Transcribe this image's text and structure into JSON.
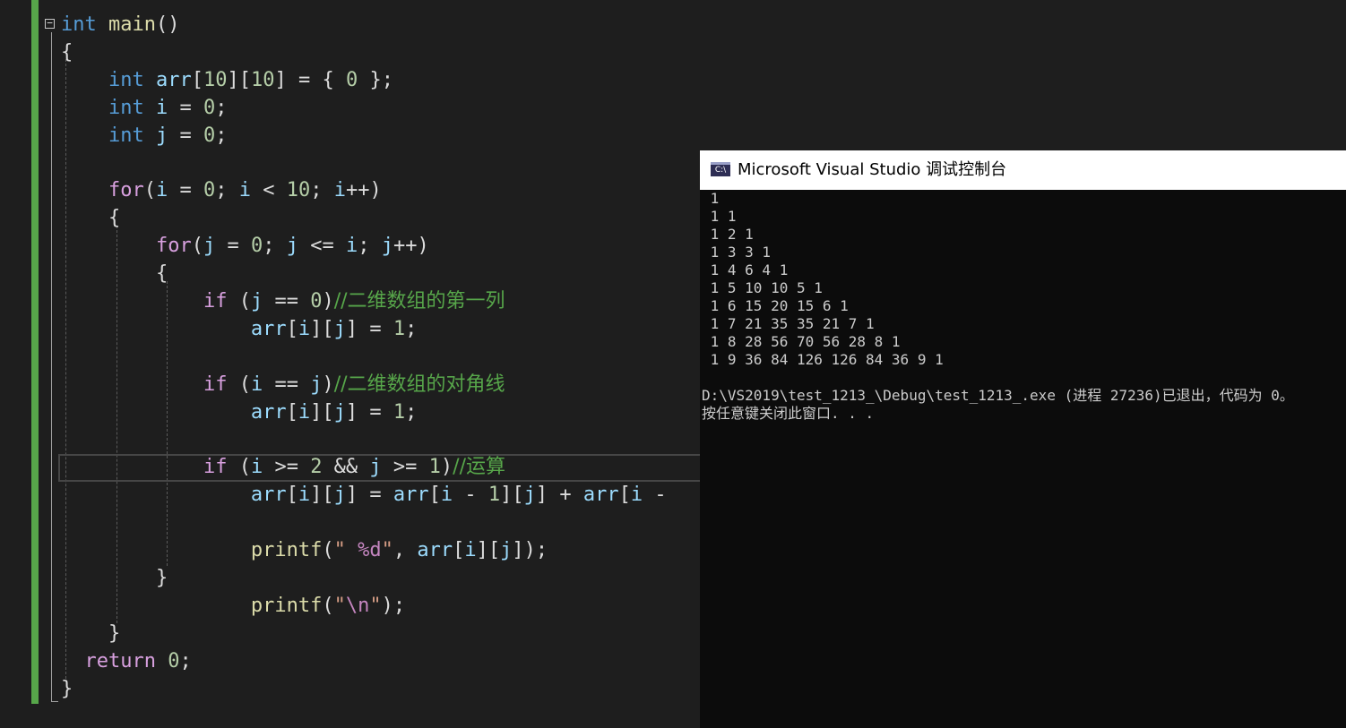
{
  "code": {
    "lines": [
      {
        "line": "line01",
        "tokens": [
          {
            "c": "kw",
            "t": "int"
          },
          {
            "c": "p",
            "t": " "
          },
          {
            "c": "fn",
            "t": "main"
          },
          {
            "c": "p",
            "t": "()"
          }
        ]
      },
      {
        "line": "line02",
        "tokens": [
          {
            "c": "p",
            "t": "{"
          }
        ]
      },
      {
        "line": "line03",
        "tokens": [
          {
            "c": "p",
            "t": "    "
          },
          {
            "c": "kw",
            "t": "int"
          },
          {
            "c": "p",
            "t": " "
          },
          {
            "c": "var",
            "t": "arr"
          },
          {
            "c": "p",
            "t": "["
          },
          {
            "c": "num",
            "t": "10"
          },
          {
            "c": "p",
            "t": "]["
          },
          {
            "c": "num",
            "t": "10"
          },
          {
            "c": "p",
            "t": "] = { "
          },
          {
            "c": "num",
            "t": "0"
          },
          {
            "c": "p",
            "t": " };"
          }
        ]
      },
      {
        "line": "line04",
        "tokens": [
          {
            "c": "p",
            "t": "    "
          },
          {
            "c": "kw",
            "t": "int"
          },
          {
            "c": "p",
            "t": " "
          },
          {
            "c": "var",
            "t": "i"
          },
          {
            "c": "p",
            "t": " = "
          },
          {
            "c": "num",
            "t": "0"
          },
          {
            "c": "p",
            "t": ";"
          }
        ]
      },
      {
        "line": "line05",
        "tokens": [
          {
            "c": "p",
            "t": "    "
          },
          {
            "c": "kw",
            "t": "int"
          },
          {
            "c": "p",
            "t": " "
          },
          {
            "c": "var",
            "t": "j"
          },
          {
            "c": "p",
            "t": " = "
          },
          {
            "c": "num",
            "t": "0"
          },
          {
            "c": "p",
            "t": ";"
          }
        ]
      },
      {
        "line": "line06",
        "tokens": []
      },
      {
        "line": "line07",
        "tokens": [
          {
            "c": "p",
            "t": "    "
          },
          {
            "c": "ctl",
            "t": "for"
          },
          {
            "c": "p",
            "t": "("
          },
          {
            "c": "var",
            "t": "i"
          },
          {
            "c": "p",
            "t": " = "
          },
          {
            "c": "num",
            "t": "0"
          },
          {
            "c": "p",
            "t": "; "
          },
          {
            "c": "var",
            "t": "i"
          },
          {
            "c": "p",
            "t": " < "
          },
          {
            "c": "num",
            "t": "10"
          },
          {
            "c": "p",
            "t": "; "
          },
          {
            "c": "var",
            "t": "i"
          },
          {
            "c": "p",
            "t": "++)"
          }
        ]
      },
      {
        "line": "line08",
        "tokens": [
          {
            "c": "p",
            "t": "    {"
          }
        ]
      },
      {
        "line": "line09",
        "tokens": [
          {
            "c": "p",
            "t": "        "
          },
          {
            "c": "ctl",
            "t": "for"
          },
          {
            "c": "p",
            "t": "("
          },
          {
            "c": "var",
            "t": "j"
          },
          {
            "c": "p",
            "t": " = "
          },
          {
            "c": "num",
            "t": "0"
          },
          {
            "c": "p",
            "t": "; "
          },
          {
            "c": "var",
            "t": "j"
          },
          {
            "c": "p",
            "t": " <= "
          },
          {
            "c": "var",
            "t": "i"
          },
          {
            "c": "p",
            "t": "; "
          },
          {
            "c": "var",
            "t": "j"
          },
          {
            "c": "p",
            "t": "++)"
          }
        ]
      },
      {
        "line": "line10",
        "tokens": [
          {
            "c": "p",
            "t": "        {"
          }
        ]
      },
      {
        "line": "line11",
        "tokens": [
          {
            "c": "p",
            "t": "            "
          },
          {
            "c": "ctl",
            "t": "if"
          },
          {
            "c": "p",
            "t": " ("
          },
          {
            "c": "var",
            "t": "j"
          },
          {
            "c": "p",
            "t": " == "
          },
          {
            "c": "num",
            "t": "0"
          },
          {
            "c": "p",
            "t": ")"
          },
          {
            "c": "cmt",
            "t": "//二维数组的第一列"
          }
        ]
      },
      {
        "line": "line12",
        "tokens": [
          {
            "c": "p",
            "t": "                "
          },
          {
            "c": "var",
            "t": "arr"
          },
          {
            "c": "p",
            "t": "["
          },
          {
            "c": "var",
            "t": "i"
          },
          {
            "c": "p",
            "t": "]["
          },
          {
            "c": "var",
            "t": "j"
          },
          {
            "c": "p",
            "t": "] = "
          },
          {
            "c": "num",
            "t": "1"
          },
          {
            "c": "p",
            "t": ";"
          }
        ]
      },
      {
        "line": "line13",
        "tokens": []
      },
      {
        "line": "line14",
        "tokens": [
          {
            "c": "p",
            "t": "            "
          },
          {
            "c": "ctl",
            "t": "if"
          },
          {
            "c": "p",
            "t": " ("
          },
          {
            "c": "var",
            "t": "i"
          },
          {
            "c": "p",
            "t": " == "
          },
          {
            "c": "var",
            "t": "j"
          },
          {
            "c": "p",
            "t": ")"
          },
          {
            "c": "cmt",
            "t": "//二维数组的对角线"
          }
        ]
      },
      {
        "line": "line15",
        "tokens": [
          {
            "c": "p",
            "t": "                "
          },
          {
            "c": "var",
            "t": "arr"
          },
          {
            "c": "p",
            "t": "["
          },
          {
            "c": "var",
            "t": "i"
          },
          {
            "c": "p",
            "t": "]["
          },
          {
            "c": "var",
            "t": "j"
          },
          {
            "c": "p",
            "t": "] = "
          },
          {
            "c": "num",
            "t": "1"
          },
          {
            "c": "p",
            "t": ";"
          }
        ]
      },
      {
        "line": "line16",
        "tokens": []
      },
      {
        "line": "line17",
        "tokens": [
          {
            "c": "p",
            "t": "            "
          },
          {
            "c": "ctl",
            "t": "if"
          },
          {
            "c": "p",
            "t": " ("
          },
          {
            "c": "var",
            "t": "i"
          },
          {
            "c": "p",
            "t": " >= "
          },
          {
            "c": "num",
            "t": "2"
          },
          {
            "c": "p",
            "t": " && "
          },
          {
            "c": "var",
            "t": "j"
          },
          {
            "c": "p",
            "t": " >= "
          },
          {
            "c": "num",
            "t": "1"
          },
          {
            "c": "p",
            "t": ")"
          },
          {
            "c": "cmt",
            "t": "//运算"
          }
        ]
      },
      {
        "line": "line18",
        "tokens": [
          {
            "c": "p",
            "t": "                "
          },
          {
            "c": "var",
            "t": "arr"
          },
          {
            "c": "p",
            "t": "["
          },
          {
            "c": "var",
            "t": "i"
          },
          {
            "c": "p",
            "t": "]["
          },
          {
            "c": "var",
            "t": "j"
          },
          {
            "c": "p",
            "t": "] = "
          },
          {
            "c": "var",
            "t": "arr"
          },
          {
            "c": "p",
            "t": "["
          },
          {
            "c": "var",
            "t": "i"
          },
          {
            "c": "p",
            "t": " - "
          },
          {
            "c": "num",
            "t": "1"
          },
          {
            "c": "p",
            "t": "]["
          },
          {
            "c": "var",
            "t": "j"
          },
          {
            "c": "p",
            "t": "] + "
          },
          {
            "c": "var",
            "t": "arr"
          },
          {
            "c": "p",
            "t": "["
          },
          {
            "c": "var",
            "t": "i"
          },
          {
            "c": "p",
            "t": " -"
          }
        ]
      },
      {
        "line": "line19",
        "tokens": []
      },
      {
        "line": "line20",
        "tokens": [
          {
            "c": "p",
            "t": "                "
          },
          {
            "c": "fn",
            "t": "printf"
          },
          {
            "c": "p",
            "t": "("
          },
          {
            "c": "str",
            "t": "\" "
          },
          {
            "c": "fmt",
            "t": "%d"
          },
          {
            "c": "str",
            "t": "\""
          },
          {
            "c": "p",
            "t": ", "
          },
          {
            "c": "var",
            "t": "arr"
          },
          {
            "c": "p",
            "t": "["
          },
          {
            "c": "var",
            "t": "i"
          },
          {
            "c": "p",
            "t": "]["
          },
          {
            "c": "var",
            "t": "j"
          },
          {
            "c": "p",
            "t": "]);"
          }
        ]
      },
      {
        "line": "line21",
        "tokens": [
          {
            "c": "p",
            "t": "        }"
          }
        ]
      },
      {
        "line": "line22",
        "tokens": [
          {
            "c": "p",
            "t": "                "
          },
          {
            "c": "fn",
            "t": "printf"
          },
          {
            "c": "p",
            "t": "("
          },
          {
            "c": "str",
            "t": "\""
          },
          {
            "c": "fmt",
            "t": "\\n"
          },
          {
            "c": "str",
            "t": "\""
          },
          {
            "c": "p",
            "t": ");"
          }
        ]
      },
      {
        "line": "line23",
        "tokens": [
          {
            "c": "p",
            "t": "    }"
          }
        ]
      },
      {
        "line": "line24",
        "tokens": [
          {
            "c": "p",
            "t": "  "
          },
          {
            "c": "ctl",
            "t": "return"
          },
          {
            "c": "p",
            "t": " "
          },
          {
            "c": "num",
            "t": "0"
          },
          {
            "c": "p",
            "t": ";"
          }
        ]
      },
      {
        "line": "line25",
        "tokens": [
          {
            "c": "p",
            "t": "}"
          }
        ]
      }
    ]
  },
  "console": {
    "title": "Microsoft Visual Studio 调试控制台",
    "icon_label": "C:\\",
    "icon_name": "console-app-icon",
    "output_lines": [
      " 1",
      " 1 1",
      " 1 2 1",
      " 1 3 3 1",
      " 1 4 6 4 1",
      " 1 5 10 10 5 1",
      " 1 6 15 20 15 6 1",
      " 1 7 21 35 35 21 7 1",
      " 1 8 28 56 70 56 28 8 1",
      " 1 9 36 84 126 126 84 36 9 1",
      "",
      "D:\\VS2019\\test_1213_\\Debug\\test_1213_.exe (进程 27236)已退出，代码为 0。",
      "按任意键关闭此窗口. . ."
    ]
  }
}
